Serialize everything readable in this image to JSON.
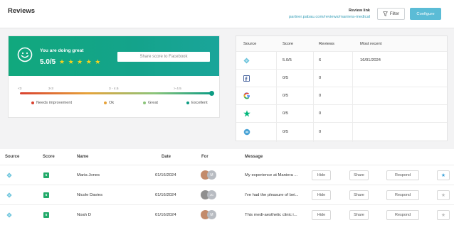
{
  "header": {
    "title": "Reviews",
    "review_link_label": "Review link",
    "review_link_url": "partner.pabau.com/reviews/maniera-medical",
    "filter_label": "Filter",
    "configure_label": "Configure"
  },
  "summary": {
    "headline": "You are doing great",
    "score": "5.0/5",
    "stars": "★ ★ ★ ★ ★",
    "share_label": "Share score to Facebook",
    "scale_ticks": [
      "<3",
      "3-3",
      "3 - 4.5",
      "> 4.5"
    ],
    "legend": [
      {
        "label": "Needs improvement",
        "color": "#d9412f"
      },
      {
        "label": "Ok",
        "color": "#e6a239"
      },
      {
        "label": "Great",
        "color": "#8bc47a"
      },
      {
        "label": "Excellent",
        "color": "#0d9c83"
      }
    ]
  },
  "sources_table": {
    "headers": [
      "Source",
      "Score",
      "Reviews",
      "Most recent"
    ],
    "rows": [
      {
        "icon": "pabau-icon",
        "score": "5.0/5",
        "reviews": "6",
        "recent": "16/01/2024"
      },
      {
        "icon": "facebook-icon",
        "score": "0/5",
        "reviews": "0",
        "recent": ""
      },
      {
        "icon": "google-icon",
        "score": "0/5",
        "reviews": "0",
        "recent": ""
      },
      {
        "icon": "trustpilot-icon",
        "score": "0/5",
        "reviews": "0",
        "recent": ""
      },
      {
        "icon": "other-source-icon",
        "score": "0/5",
        "reviews": "0",
        "recent": ""
      }
    ]
  },
  "reviews_table": {
    "headers": [
      "Source",
      "Score",
      "Name",
      "Date",
      "For",
      "Message"
    ],
    "rows": [
      {
        "score": "5",
        "name": "Maria Jones",
        "date": "01/16/2024",
        "for_initial": "M",
        "message": "My experience at Maniera ...",
        "hide": "Hide",
        "share": "Share",
        "respond": "Respond",
        "starred": true
      },
      {
        "score": "5",
        "name": "Nicole Davies",
        "date": "01/16/2024",
        "for_initial": "JC",
        "message": "I've had the pleasure of bei...",
        "hide": "Hide",
        "share": "Share",
        "respond": "Respond",
        "starred": false
      },
      {
        "score": "5",
        "name": "Noah D",
        "date": "01/16/2024",
        "for_initial": "M",
        "message": "This medi-aesthetic clinic i...",
        "hide": "Hide",
        "share": "Share",
        "respond": "Respond",
        "starred": false
      }
    ]
  },
  "colors": {
    "accent": "#5bbcd6",
    "banner": "#11a87d",
    "score_badge": "#22aa6a"
  }
}
